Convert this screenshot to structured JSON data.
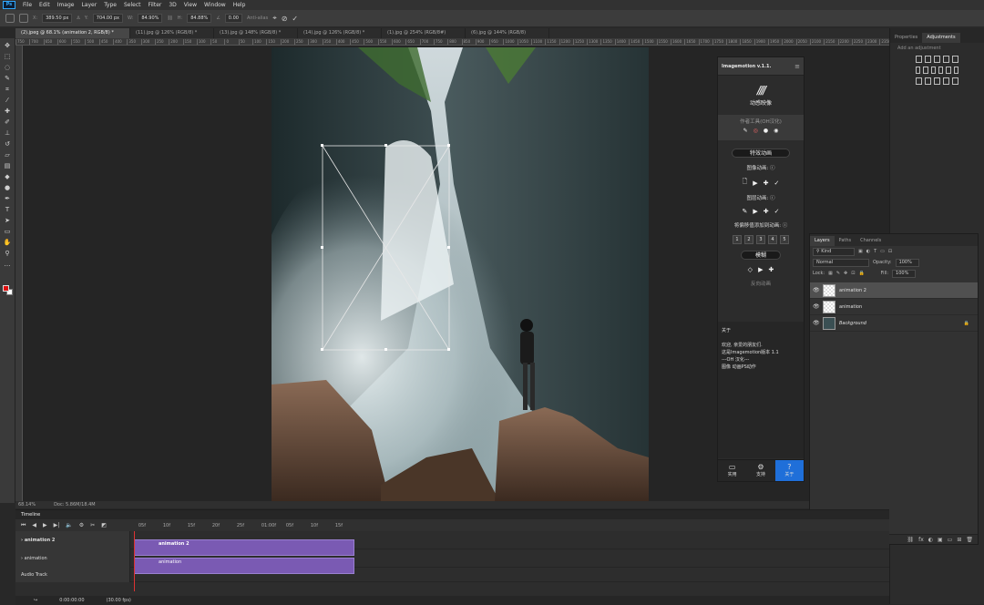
{
  "menu": [
    "File",
    "Edit",
    "Image",
    "Layer",
    "Type",
    "Select",
    "Filter",
    "3D",
    "View",
    "Window",
    "Help"
  ],
  "app_logo": "Ps",
  "options": {
    "x_label": "X:",
    "x": "389.50 px",
    "y_label": "Y:",
    "y": "704.00 px",
    "w_label": "W:",
    "w": "84.90%",
    "h_label": "H:",
    "h": "84.88%",
    "angle": "0.00",
    "antialias": "Anti-alias"
  },
  "tabs": [
    "(2).jpeg @ 68.1% (animation 2, RGB/8) *",
    "(11).jpg @ 126% (RGB/8) *",
    "(13).jpg @ 148% (RGB/8) *",
    "(14).jpg @ 126% (RGB/8) *",
    "(1).jpg @ 254% (RGB/8#)",
    "(6).jpg @ 144% (RGB/8)"
  ],
  "ruler_ticks": [
    "750",
    "700",
    "650",
    "600",
    "550",
    "500",
    "450",
    "400",
    "350",
    "300",
    "250",
    "200",
    "150",
    "100",
    "50",
    "0",
    "50",
    "100",
    "150",
    "200",
    "250",
    "300",
    "350",
    "400",
    "450",
    "500",
    "550",
    "600",
    "650",
    "700",
    "750",
    "800",
    "850",
    "900",
    "950",
    "1000",
    "1050",
    "1100",
    "1150",
    "1200",
    "1250",
    "1300",
    "1350",
    "1400",
    "1450",
    "1500",
    "1550",
    "1600",
    "1650",
    "1700",
    "1750",
    "1800",
    "1850",
    "1900",
    "1950",
    "2000",
    "2050",
    "2100",
    "2150",
    "2200",
    "2250",
    "2300",
    "2350"
  ],
  "status": {
    "zoom": "68.14%",
    "doc": "Doc: 5.86M/18.4M"
  },
  "imagemotion": {
    "title": "Imagemotion v.1.1.",
    "brand": "动感映像",
    "subtitle": "作者工具(OH汉化)",
    "fx_button": "特效动画",
    "image_anim": "图像动画:",
    "layer_anim": "图层动画:",
    "add_anim": "将偏移值添加到动画:",
    "numbers": [
      "1",
      "2",
      "3",
      "4",
      "5"
    ],
    "blur_button": "模糊",
    "reverse": "反向动画",
    "about_title": "关于",
    "about_lines": [
      "欢迎, 亲爱的朋友们.",
      "这是Imagemotion版本 1.1",
      "---OH 汉化---",
      "图像      动画PS动作"
    ],
    "footer": [
      {
        "icon": "▭",
        "label": "实用"
      },
      {
        "icon": "⚙",
        "label": "支持"
      },
      {
        "icon": "?",
        "label": "关于"
      }
    ]
  },
  "dock": {
    "tabs": [
      "Properties",
      "Adjustments"
    ],
    "add_adjustment": "Add an adjustment"
  },
  "layers_panel": {
    "tabs": [
      "Layers",
      "Paths",
      "Channels"
    ],
    "kind": "Kind",
    "blend": "Normal",
    "opacity_label": "Opacity:",
    "opacity": "100%",
    "lock_label": "Lock:",
    "fill_label": "Fill:",
    "fill": "100%",
    "layers": [
      {
        "name": "animation 2",
        "selected": true
      },
      {
        "name": "animation",
        "selected": false
      },
      {
        "name": "Background",
        "selected": false
      }
    ],
    "footer_icons": [
      "⛓",
      "fx",
      "◐",
      "▣",
      "▭",
      "⊞",
      "🗑"
    ]
  },
  "timeline": {
    "title": "Timeline",
    "tracks": [
      "animation 2",
      "animation",
      "Audio Track"
    ],
    "ruler": [
      "05f",
      "10f",
      "15f",
      "20f",
      "25f",
      "01:00f",
      "05f",
      "10f",
      "15f"
    ],
    "clips": [
      "animation 2",
      "animation"
    ],
    "time": "0:00:00:00",
    "fps": "(30.00 fps)"
  }
}
